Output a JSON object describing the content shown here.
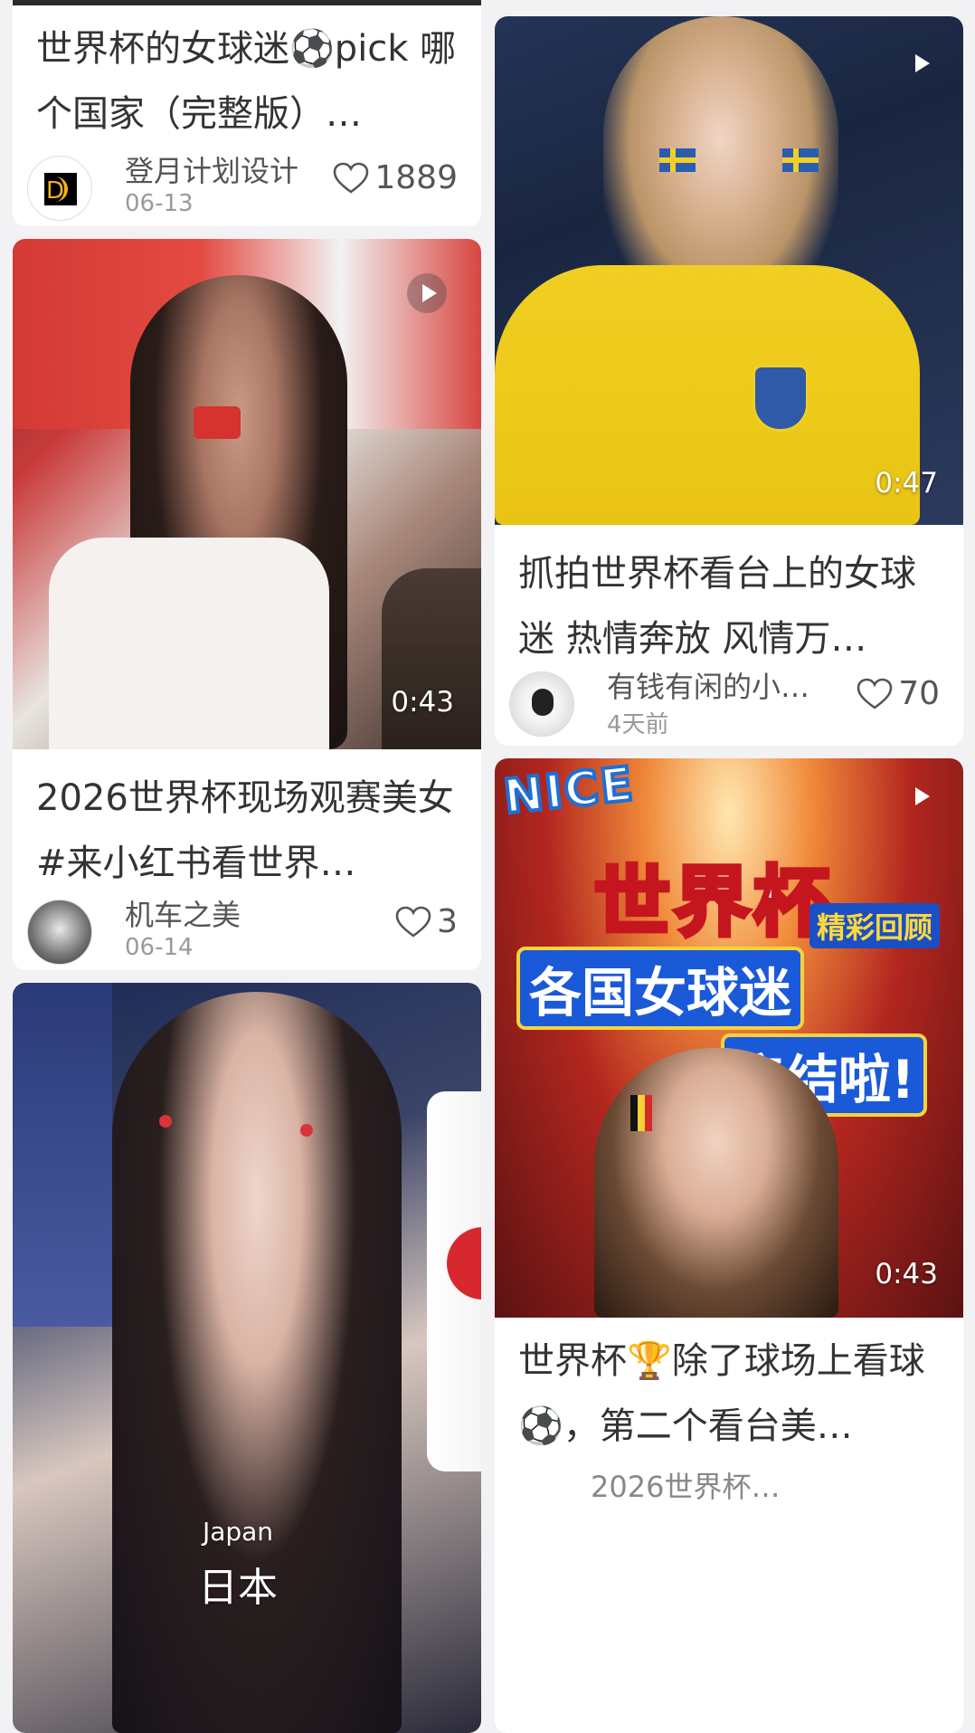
{
  "feed": [
    {
      "title": "世界杯的女球迷⚽pick 哪个国家（完整版）…",
      "author": "登月计划设计",
      "date": "06-13",
      "likes": "1889"
    },
    {
      "title": "抓拍世界杯看台上的女球迷 热情奔放 风情万…",
      "author": "有钱有闲的小…",
      "date": "4天前",
      "likes": "70",
      "duration": "0:47"
    },
    {
      "title": "2026世界杯现场观赛美女 #来小红书看世界…",
      "author": "机车之美",
      "date": "06-14",
      "likes": "3",
      "duration": "0:43"
    },
    {
      "duration": "0:43",
      "overlay": {
        "nice": "NICE",
        "main": "世界杯",
        "badge": "精彩回顾",
        "line2": "各国女球迷",
        "line3": "集结啦!"
      },
      "title": "世界杯🏆除了球场上看球⚽，第二个看台美…",
      "author": "2026世界杯精…"
    },
    {
      "caption_en": "Japan",
      "caption_zh": "日本"
    }
  ]
}
